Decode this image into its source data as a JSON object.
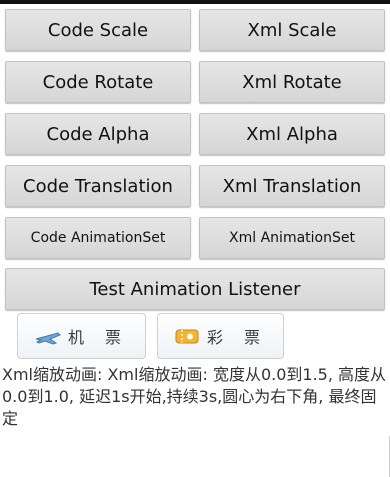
{
  "buttons": {
    "code_scale": "Code Scale",
    "xml_scale": "Xml Scale",
    "code_rotate": "Code Rotate",
    "xml_rotate": "Xml Rotate",
    "code_alpha": "Code Alpha",
    "xml_alpha": "Xml Alpha",
    "code_translation": "Code Translation",
    "xml_translation": "Xml Translation",
    "code_animationset": "Code AnimationSet",
    "xml_animationset": "Xml AnimationSet",
    "test_listener": "Test Animation Listener"
  },
  "image_buttons": {
    "flight_label": "机 票",
    "lottery_label": "彩 票",
    "flight_icon": "airplane-icon",
    "lottery_icon": "lottery-ticket-icon"
  },
  "description": "Xml缩放动画: Xml缩放动画: 宽度从0.0到1.5, 高度从0.0到1.0, 延迟1s开始,持续3s,圆心为右下角, 最终固定"
}
